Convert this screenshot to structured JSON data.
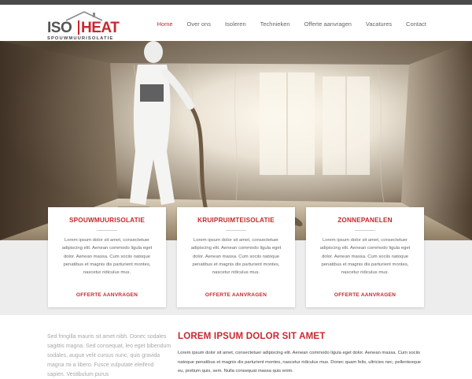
{
  "brand": {
    "name_left": "ISO",
    "name_right": "HEAT",
    "tagline": "SPOUWMUURISOLATIE",
    "accent_color": "#c8272e"
  },
  "nav": {
    "items": [
      {
        "label": "Home",
        "active": true
      },
      {
        "label": "Over ons",
        "active": false
      },
      {
        "label": "Isoleren",
        "active": false
      },
      {
        "label": "Technieken",
        "active": false
      },
      {
        "label": "Offerte aanvragen",
        "active": false
      },
      {
        "label": "Vacatures",
        "active": false
      },
      {
        "label": "Contact",
        "active": false
      }
    ]
  },
  "cards": [
    {
      "title": "SPOUWMUURISOLATIE",
      "text": "Lorem ipsum dolor sit amet, consectetuer adipiscing elit. Aenean commodo ligula eget dolor. Aenean massa. Cum sociis natoque penatibus et magnis dis parturient montes, nascetur ridiculus mus.",
      "cta": "OFFERTE AANVRAGEN"
    },
    {
      "title": "KRUIPRUIMTEISOLATIE",
      "text": "Lorem ipsum dolor sit amet, consectetuer adipiscing elit. Aenean commodo ligula eget dolor. Aenean massa. Cum sociis natoque penatibus et magnis dis parturient montes, nascetur ridiculus mus.",
      "cta": "OFFERTE AANVRAGEN"
    },
    {
      "title": "ZONNEPANELEN",
      "text": "Lorem ipsum dolor sit amet, consectetuer adipiscing elit. Aenean commodo ligula eget dolor. Aenean massa. Cum sociis natoque penatibus et magnis dis parturient montes, nascetur ridiculus mus.",
      "cta": "OFFERTE AANVRAGEN"
    }
  ],
  "sidebar_text": "Sed fringilla mauris sit amet nibh. Donec sodales sagittis magna. Sed consequat, leo eget bibendum sodales, augue velit cursus nunc, quis gravida magna mi a libero. Fusce vulputate eleifend sapien. Vestibulum purus",
  "main": {
    "title": "LOREM IPSUM DOLOR SIT AMET",
    "text": "Lorem ipsum dolor sit amet, consectetuer adipiscing elit. Aenean commodo ligula eget dolor. Aenean massa. Cum sociis natoque penatibus et magnis dis parturient montes, nascetur ridiculus mus. Donec quam felis, ultricies nec, pellentesque eu, pretium quis, sem. Nulla consequat massa quis enim."
  }
}
